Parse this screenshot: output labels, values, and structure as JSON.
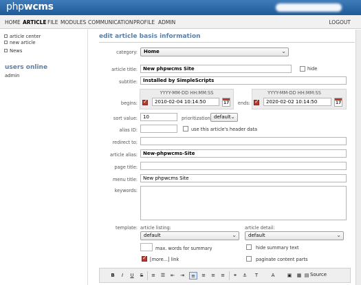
{
  "header": {
    "logo_light": "php",
    "logo_bold": "wcms"
  },
  "nav": {
    "items": [
      "HOME",
      "ARTICLE",
      "FILE",
      "MODULES",
      "COMMUNICATION",
      "PROFILE",
      "ADMIN"
    ],
    "active": "ARTICLE",
    "logout": "LOGOUT"
  },
  "sidebar": {
    "links": [
      "article center",
      "new article",
      "News"
    ],
    "users_title": "users online",
    "users": [
      "admin"
    ]
  },
  "form": {
    "title": "edit article basis information",
    "category_label": "category:",
    "category_value": "Home",
    "article_title_label": "article title:",
    "article_title_value": "New phpwcms Site",
    "hide_label": "hide",
    "subtitle_label": "subtitle:",
    "subtitle_value": "Installed by SimpleScripts",
    "date_format": "YYYY-MM-DD HH:MM:SS",
    "begins_label": "begins:",
    "begins_value": "2010-02-04 10:14:50",
    "ends_label": "ends:",
    "ends_value": "2020-02-02 10:14:50",
    "calendar_day": "17",
    "sort_label": "sort value:",
    "sort_value": "10",
    "prioritization_label": "prioritization:",
    "prioritization_value": "default",
    "alias_id_label": "alias ID:",
    "alias_id_value": "",
    "header_data_label": "use this article's header data",
    "redirect_label": "redirect to:",
    "redirect_value": "",
    "article_alias_label": "article alias:",
    "article_alias_value": "New-phpwcms-Site",
    "page_title_label": "page title:",
    "page_title_value": "",
    "menu_title_label": "menu title:",
    "menu_title_value": "New phpwcms Site",
    "keywords_label": "keywords:",
    "template_label": "template:",
    "article_listing_label": "article listing:",
    "article_listing_value": "default",
    "article_detail_label": "article detail:",
    "article_detail_value": "default",
    "max_words_label": "max. words for summary",
    "max_words_value": "",
    "hide_summary_label": "hide summary text",
    "more_link_label": "[more...] link",
    "paginate_label": "paginate content parts"
  },
  "toolbar": {
    "buttons": [
      "B",
      "I",
      "U",
      "S",
      "ol",
      "ul",
      "outdent",
      "indent",
      "left",
      "center",
      "right",
      "justify",
      "link",
      "unlink",
      "image",
      "table",
      "style",
      "color",
      "code",
      "source-icon"
    ],
    "source_label": "Source"
  }
}
